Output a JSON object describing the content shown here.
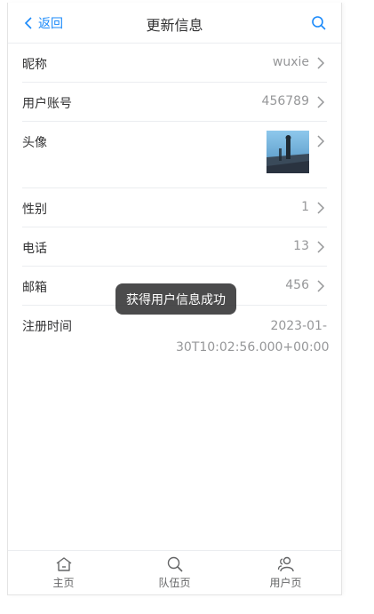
{
  "navbar": {
    "back_label": "返回",
    "title": "更新信息"
  },
  "fields": [
    {
      "label": "昵称",
      "value": "wuxie"
    },
    {
      "label": "用户账号",
      "value": "456789"
    },
    {
      "label": "头像",
      "value": ""
    },
    {
      "label": "性别",
      "value": "1"
    },
    {
      "label": "电话",
      "value": "13"
    },
    {
      "label": "邮箱",
      "value": "456"
    },
    {
      "label": "注册时间",
      "value_line1": "2023-01-",
      "value_line2": "30T10:02:56.000+00:00"
    }
  ],
  "toast": {
    "message": "获得用户信息成功"
  },
  "tabbar": {
    "tabs": [
      {
        "label": "主页",
        "icon": "home-icon"
      },
      {
        "label": "队伍页",
        "icon": "search-icon"
      },
      {
        "label": "用户页",
        "icon": "friends-icon"
      }
    ]
  },
  "colors": {
    "accent": "#1989fa",
    "text": "#323233",
    "muted": "#969799",
    "divider": "#ebedf0"
  }
}
